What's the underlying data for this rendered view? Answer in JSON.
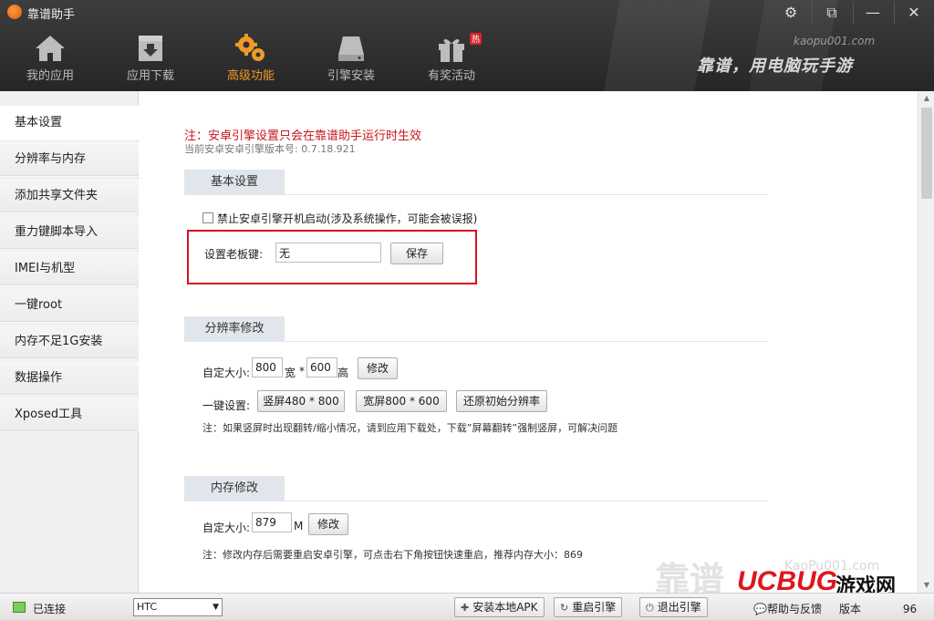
{
  "app": {
    "title": "靠谱助手",
    "site": "kaopu001.com",
    "slogan": "靠谱，用电脑玩手游"
  },
  "nav": [
    {
      "label": "我的应用",
      "icon": "home-icon"
    },
    {
      "label": "应用下载",
      "icon": "download-box-icon"
    },
    {
      "label": "高级功能",
      "icon": "gears-icon",
      "active": true
    },
    {
      "label": "引擎安装",
      "icon": "hard-drive-icon"
    },
    {
      "label": "有奖活动",
      "icon": "gift-icon",
      "badge": "热"
    }
  ],
  "sidebar": [
    {
      "label": "基本设置",
      "active": true
    },
    {
      "label": "分辨率与内存"
    },
    {
      "label": "添加共享文件夹"
    },
    {
      "label": "重力键脚本导入"
    },
    {
      "label": "IMEI与机型"
    },
    {
      "label": "一键root"
    },
    {
      "label": "内存不足1G安装"
    },
    {
      "label": "数据操作"
    },
    {
      "label": "Xposed工具"
    }
  ],
  "content": {
    "notice": "注：安卓引擎设置只会在靠谱助手运行时生效",
    "version_info": "当前安卓安卓引擎版本号: 0.7.18.921",
    "basic": {
      "title": "基本设置",
      "checkbox_label": "禁止安卓引擎开机启动(涉及系统操作，可能会被误报)",
      "boss_key_label": "设置老板键:",
      "boss_key_value": "无",
      "save_label": "保存"
    },
    "resolution": {
      "title": "分辨率修改",
      "custom_label": "自定大小:",
      "width_value": "800",
      "width_unit": "宽",
      "times": "*",
      "height_value": "600",
      "height_unit": "高",
      "modify_label": "修改",
      "preset_label": "一键设置:",
      "preset_portrait": "竖屏480 * 800",
      "preset_landscape": "宽屏800 * 600",
      "preset_reset": "还原初始分辨率",
      "note": "注：如果竖屏时出现翻转/缩小情况，请到应用下载处，下载”屏幕翻转”强制竖屏，可解决问题"
    },
    "memory": {
      "title": "内存修改",
      "custom_label": "自定大小:",
      "value": "879",
      "unit": "M",
      "modify_label": "修改",
      "note": "注：修改内存后需要重启安卓引擎，可点击右下角按钮快速重启，推荐内存大小：869"
    }
  },
  "status": {
    "connected": "已连接",
    "device": "HTC",
    "install_apk": "安装本地APK",
    "restart_engine": "重启引擎",
    "exit_engine": "退出引擎",
    "help": "帮助与反馈",
    "version": "版本",
    "version_num": "96"
  },
  "watermark": {
    "ghost": "靠谱",
    "ghost_site": "KaoPu001.com",
    "logo_main": "UCBUG",
    "logo_game": "游戏网",
    "logo_com": ".com"
  }
}
